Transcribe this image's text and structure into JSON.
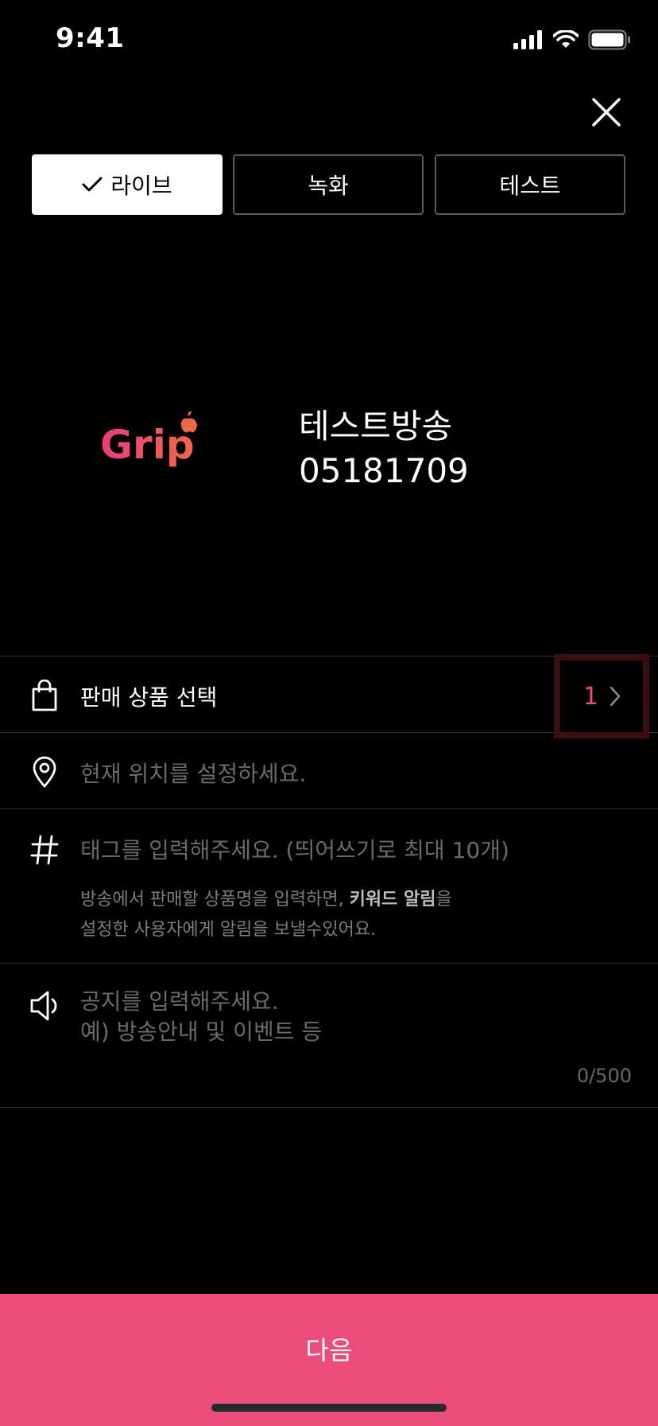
{
  "status_bar": {
    "time": "9:41"
  },
  "tabs": [
    {
      "label": "라이브",
      "selected": true
    },
    {
      "label": "녹화",
      "selected": false
    },
    {
      "label": "테스트",
      "selected": false
    }
  ],
  "broadcast": {
    "logo_text": "Grip",
    "title": "테스트방송",
    "code": "05181709"
  },
  "rows": {
    "product": {
      "label": "판매 상품 선택",
      "count": "1"
    },
    "location": {
      "placeholder": "현재 위치를 설정하세요."
    },
    "tags": {
      "placeholder": "태그를 입력해주세요. (띄어쓰기로 최대 10개)",
      "helper_part1": "방송에서 판매할 상품명을 입력하면, ",
      "helper_bold": "키워드 알림",
      "helper_part2": "을",
      "helper_line2": "설정한 사용자에게 알림을 보낼수있어요."
    },
    "notice": {
      "placeholder_line1": "공지를 입력해주세요.",
      "placeholder_line2": "예) 방송안내 및 이벤트 등",
      "counter": "0/500"
    }
  },
  "next_button": {
    "label": "다음"
  },
  "colors": {
    "accent": "#ea4c7c",
    "background": "#000000",
    "highlight_border": "#3b0e12"
  }
}
